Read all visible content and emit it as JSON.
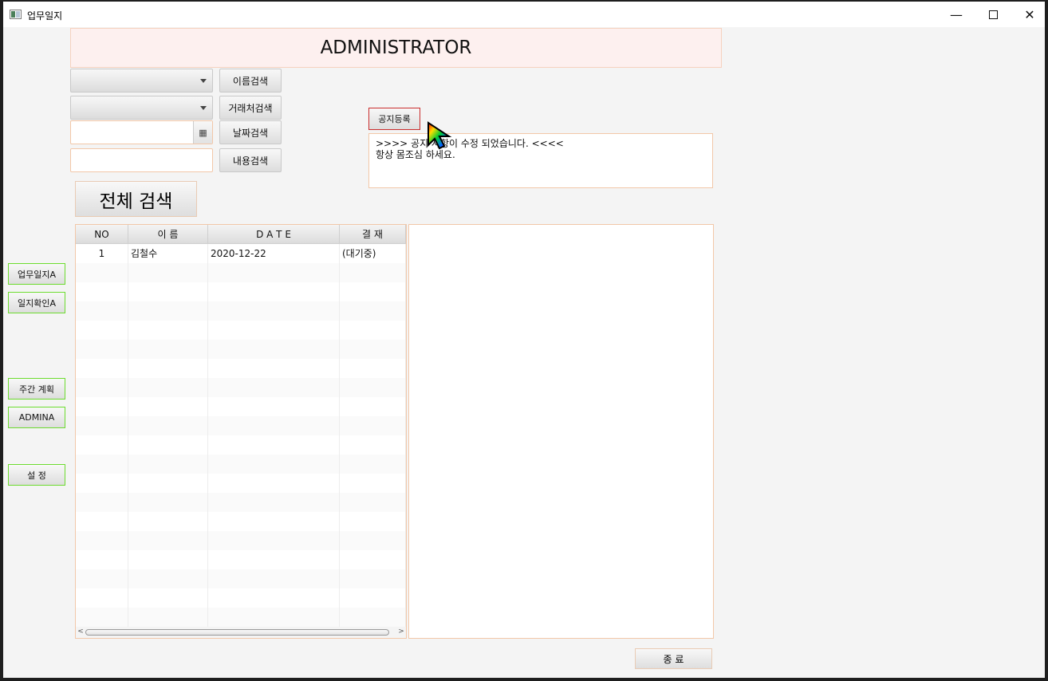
{
  "window": {
    "title": "업무일지"
  },
  "header": {
    "title": "ADMINISTRATOR"
  },
  "search": {
    "name_search": "이름검색",
    "client_search": "거래처검색",
    "date_search": "날짜검색",
    "content_search": "내용검색",
    "all_search": "전체 검색"
  },
  "sidebar": {
    "items": [
      {
        "label": "업무일지A"
      },
      {
        "label": "일지확인A"
      },
      {
        "label": "주간 계획"
      },
      {
        "label": "ADMINA"
      },
      {
        "label": "설   정"
      }
    ]
  },
  "notice": {
    "button": "공지등록",
    "line1": ">>>> 공지 사항이 수정 되었습니다. <<<<",
    "line2": "항상 몸조심 하세요."
  },
  "table": {
    "columns": [
      "NO",
      "이    름",
      "D  A  T  E",
      "결 재"
    ],
    "rows": [
      {
        "no": "1",
        "name": "김철수",
        "date": "2020-12-22",
        "status": "(대기중)"
      }
    ]
  },
  "footer": {
    "exit": "종  료"
  },
  "colors": {
    "sidebar_border": "#6cdc2e",
    "notice_border": "#ca2d2d",
    "field_border": "#f2c7a8",
    "header_bg": "#fdf0ef"
  },
  "icons": {
    "app": "app-window-icon",
    "calendar": "calendar-icon",
    "cursor": "rainbow-pointer-icon"
  }
}
